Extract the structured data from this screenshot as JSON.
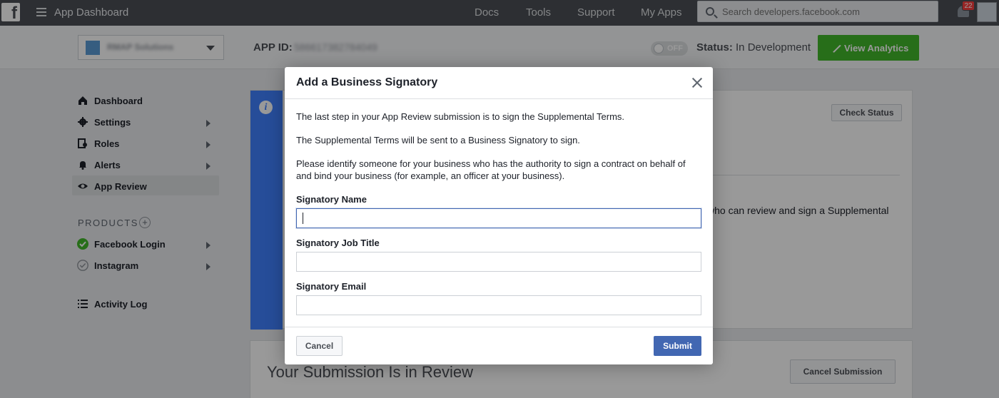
{
  "topbar": {
    "logo": "f",
    "app_title": "App Dashboard",
    "nav": [
      {
        "label": "Docs"
      },
      {
        "label": "Tools"
      },
      {
        "label": "Support"
      },
      {
        "label": "My Apps"
      }
    ],
    "search_placeholder": "Search developers.facebook.com",
    "notification_count": "22"
  },
  "appbar": {
    "app_name": "RMAP Solutions",
    "app_id_label": "APP ID:",
    "app_id_value": "586617382784049",
    "toggle_label": "OFF",
    "status_label": "Status:",
    "status_value": "In Development",
    "analytics_label": "View Analytics"
  },
  "sidebar": {
    "items": [
      {
        "label": "Dashboard",
        "icon": "home-icon"
      },
      {
        "label": "Settings",
        "icon": "gear-icon"
      },
      {
        "label": "Roles",
        "icon": "roles-icon"
      },
      {
        "label": "Alerts",
        "icon": "bell-icon"
      },
      {
        "label": "App Review",
        "icon": "eye-icon"
      }
    ],
    "products_label": "PRODUCTS",
    "products": [
      {
        "label": "Facebook Login",
        "icon": "check-circle-icon"
      },
      {
        "label": "Instagram",
        "icon": "check-circle-outline-icon"
      }
    ],
    "activity_log": "Activity Log"
  },
  "main": {
    "check_status_label": "Check Status",
    "partial_text": "who can review and sign a Supplemental",
    "review_title": "Your Submission Is in Review",
    "cancel_submission_label": "Cancel Submission"
  },
  "modal": {
    "title": "Add a Business Signatory",
    "p1": "The last step in your App Review submission is to sign the Supplemental Terms.",
    "p2": "The Supplemental Terms will be sent to a Business Signatory to sign.",
    "p3": "Please identify someone for your business who has the authority to sign a contract on behalf of and bind your business (for example, an officer at your business).",
    "fields": [
      {
        "label": "Signatory Name",
        "value": ""
      },
      {
        "label": "Signatory Job Title",
        "value": ""
      },
      {
        "label": "Signatory Email",
        "value": ""
      }
    ],
    "cancel_label": "Cancel",
    "submit_label": "Submit"
  },
  "colors": {
    "topbar": "#4b4f56",
    "analytics_green": "#42b72a",
    "info_blue": "#4080ff",
    "submit_blue": "#4267b2"
  }
}
